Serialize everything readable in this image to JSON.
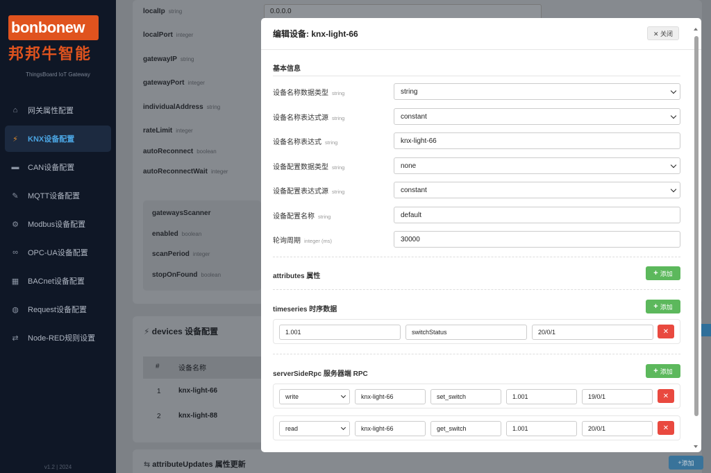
{
  "sidebar": {
    "logo_text": "bonbonew",
    "logo_cn": "邦邦牛智能",
    "subtitle": "ThingsBoard IoT Gateway",
    "items": [
      {
        "icon": "home-icon",
        "glyph": "⌂",
        "label": "网关属性配置"
      },
      {
        "icon": "lightning-icon",
        "glyph": "⚡",
        "label": "KNX设备配置",
        "active": true
      },
      {
        "icon": "car-icon",
        "glyph": "▬",
        "label": "CAN设备配置"
      },
      {
        "icon": "feather-icon",
        "glyph": "✎",
        "label": "MQTT设备配置"
      },
      {
        "icon": "gear-icon",
        "glyph": "⚙",
        "label": "Modbus设备配置"
      },
      {
        "icon": "link-icon",
        "glyph": "∞",
        "label": "OPC-UA设备配置"
      },
      {
        "icon": "building-icon",
        "glyph": "▦",
        "label": "BACnet设备配置"
      },
      {
        "icon": "globe-icon",
        "glyph": "◍",
        "label": "Request设备配置"
      },
      {
        "icon": "shuffle-icon",
        "glyph": "⇄",
        "label": "Node-RED规则设置"
      }
    ],
    "version": "v1.2 | 2024"
  },
  "background": {
    "rows": [
      {
        "name": "localIp",
        "type": "string",
        "value": "0.0.0.0"
      },
      {
        "name": "localPort",
        "type": "integer"
      },
      {
        "name": "gatewayIP",
        "type": "string"
      },
      {
        "name": "gatewayPort",
        "type": "integer"
      },
      {
        "name": "individualAddress",
        "type": "string"
      },
      {
        "name": "rateLimit",
        "type": "integer"
      },
      {
        "name": "autoReconnect",
        "type": "boolean"
      },
      {
        "name": "autoReconnectWait",
        "type": "integer"
      }
    ],
    "scanner_rows": [
      {
        "name": "gatewaysScanner",
        "type": ""
      },
      {
        "name": "enabled",
        "type": "boolean"
      },
      {
        "name": "scanPeriod",
        "type": "integer"
      },
      {
        "name": "stopOnFound",
        "type": "boolean"
      }
    ],
    "devices_title": "devices 设备配置",
    "table_headers": [
      "#",
      "设备名称"
    ],
    "devices": [
      {
        "index": "1",
        "name": "knx-light-66"
      },
      {
        "index": "2",
        "name": "knx-light-88"
      }
    ],
    "attribute_updates_title": "attributeUpdates 属性更新",
    "add_label": "添加"
  },
  "modal": {
    "title": "编辑设备: knx-light-66",
    "close_label": "✕ 关闭",
    "basic_title": "基本信息",
    "fields": [
      {
        "label": "设备名称数据类型",
        "type": "string",
        "value": "string",
        "kind": "select"
      },
      {
        "label": "设备名称表达式源",
        "type": "string",
        "value": "constant",
        "kind": "select"
      },
      {
        "label": "设备名称表达式",
        "type": "string",
        "value": "knx-light-66",
        "kind": "input"
      },
      {
        "label": "设备配置数据类型",
        "type": "string",
        "value": "none",
        "kind": "select"
      },
      {
        "label": "设备配置表达式源",
        "type": "string",
        "value": "constant",
        "kind": "select"
      },
      {
        "label": "设备配置名称",
        "type": "string",
        "value": "default",
        "kind": "input"
      },
      {
        "label": "轮询周期",
        "type": "integer (ms)",
        "value": "30000",
        "kind": "input"
      }
    ],
    "attributes_title": "attributes 属性",
    "timeseries_title": "timeseries 时序数据",
    "timeseries_rows": [
      {
        "c1": "1.001",
        "c2": "switchStatus",
        "c3": "20/0/1"
      }
    ],
    "rpc_title": "serverSideRpc 服务器端 RPC",
    "rpc_rows": [
      {
        "method": "write",
        "device": "knx-light-66",
        "name": "set_switch",
        "addr": "1.001",
        "group": "19/0/1"
      },
      {
        "method": "read",
        "device": "knx-light-66",
        "name": "get_switch",
        "addr": "1.001",
        "group": "20/0/1"
      }
    ],
    "add_label": "添加",
    "delete_label": "✕"
  }
}
